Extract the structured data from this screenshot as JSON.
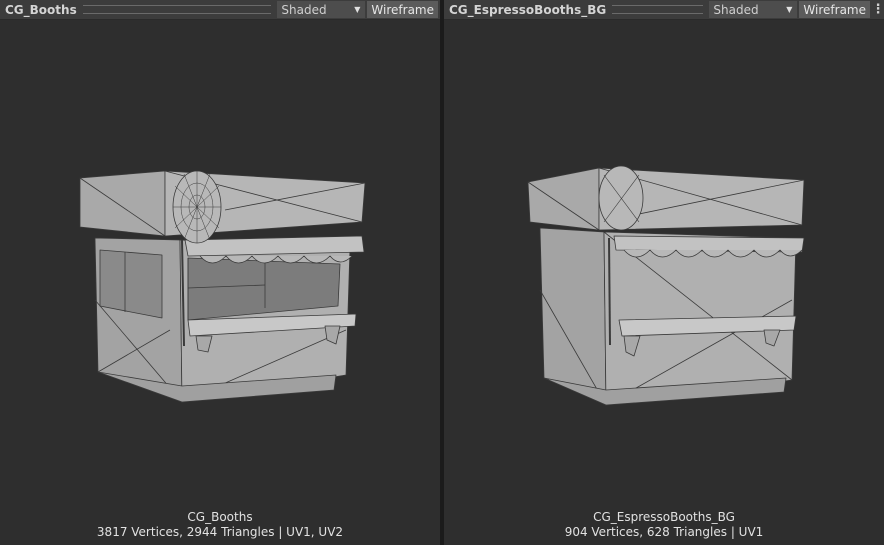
{
  "panels": [
    {
      "title": "CG_Booths",
      "shading_mode": "Shaded",
      "wireframe_label": "Wireframe",
      "mesh_name": "CG_Booths",
      "mesh_stats": "3817 Vertices, 2944 Triangles | UV1, UV2"
    },
    {
      "title": "CG_EspressoBooths_BG",
      "shading_mode": "Shaded",
      "wireframe_label": "Wireframe",
      "mesh_name": "CG_EspressoBooths_BG",
      "mesh_stats": "904 Vertices, 628 Triangles | UV1"
    }
  ],
  "colors": {
    "viewport_bg": "#2e2e2e",
    "mesh_light": "#b4b4b4",
    "mesh_mid": "#9c9c9c",
    "wire": "#3a3a3a"
  },
  "icons": {
    "dropdown": "chevron-down-icon",
    "more": "kebab-menu-icon"
  }
}
